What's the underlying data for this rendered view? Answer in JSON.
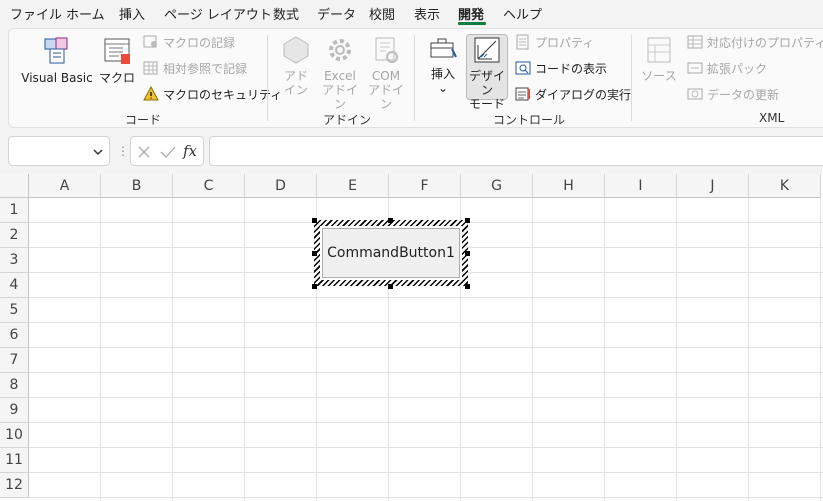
{
  "menu_tabs": [
    "ファイル",
    "ホーム",
    "挿入",
    "ページ レイアウト",
    "数式",
    "データ",
    "校閲",
    "表示",
    "開発",
    "ヘルプ"
  ],
  "active_tab": "開発",
  "ribbon": {
    "code": {
      "label": "コード",
      "visual_basic": "Visual Basic",
      "macro": "マクロ",
      "record_macro": "マクロの記録",
      "relative_ref": "相対参照で記録",
      "macro_security": "マクロのセキュリティ"
    },
    "addins": {
      "label": "アドイン",
      "addin_line1": "アド",
      "addin_line2": "イン",
      "excel_line1": "Excel",
      "excel_line2": "アドイン",
      "com_line1": "COM",
      "com_line2": "アドイン"
    },
    "controls": {
      "label": "コントロール",
      "insert": "挿入",
      "design_line1": "デザイン",
      "design_line2": "モード",
      "properties": "プロパティ",
      "view_code": "コードの表示",
      "run_dialog": "ダイアログの実行"
    },
    "xml": {
      "label": "XML",
      "source": "ソース",
      "map_props": "対応付けのプロパティ",
      "expansion_pack": "拡張パック",
      "refresh_data": "データの更新"
    }
  },
  "formula_bar": {
    "namebox_value": "",
    "fx_symbol": "fx",
    "formula_value": ""
  },
  "columns": [
    "A",
    "B",
    "C",
    "D",
    "E",
    "F",
    "G",
    "H",
    "I",
    "J",
    "K"
  ],
  "rows": [
    "1",
    "2",
    "3",
    "4",
    "5",
    "6",
    "7",
    "8",
    "9",
    "10",
    "11",
    "12"
  ],
  "command_button": {
    "caption": "CommandButton1"
  }
}
